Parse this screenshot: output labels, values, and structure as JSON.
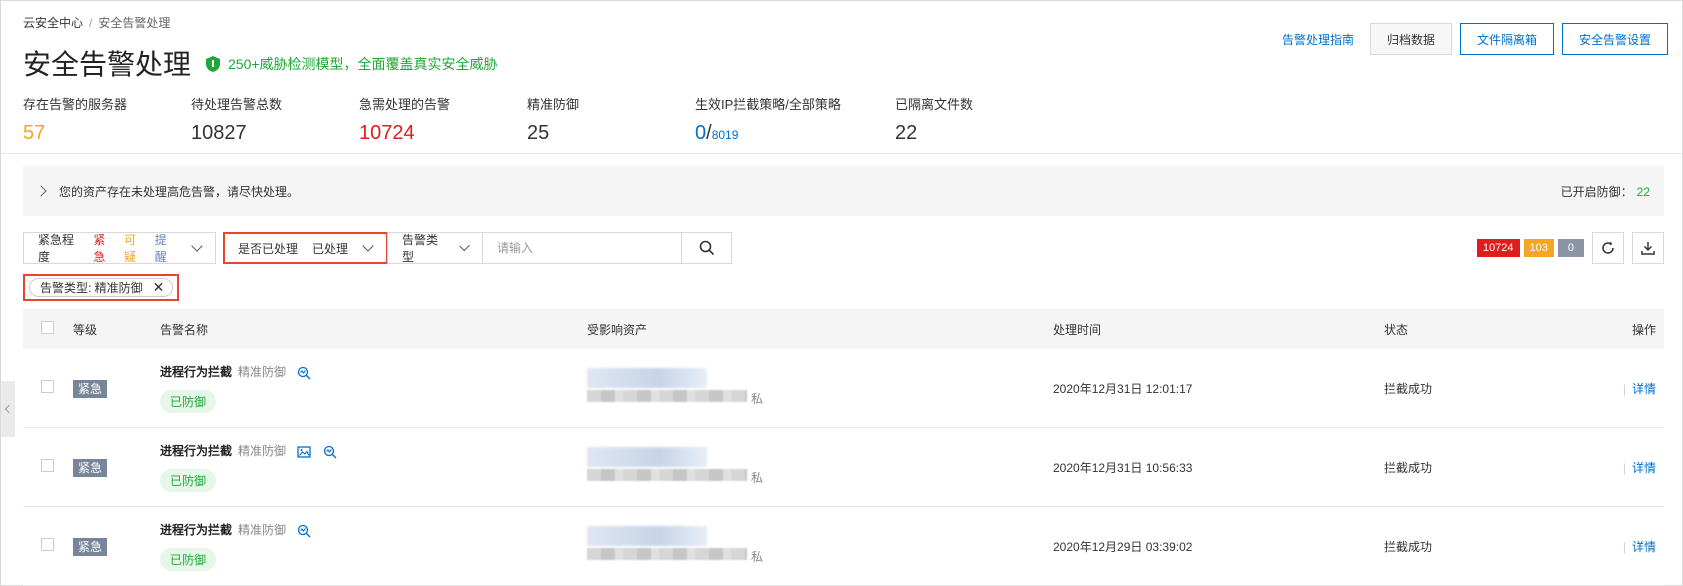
{
  "breadcrumb": {
    "root": "云安全中心",
    "sep": "/",
    "current": "安全告警处理"
  },
  "header": {
    "title": "安全告警处理",
    "badge_text": "250+威胁检测模型，全面覆盖真实安全威胁",
    "guide_link": "告警处理指南",
    "archive_btn": "归档数据",
    "quarantine_btn": "文件隔离箱",
    "settings_btn": "安全告警设置"
  },
  "stats": [
    {
      "label": "存在告警的服务器",
      "value": "57"
    },
    {
      "label": "待处理告警总数",
      "value": "10827"
    },
    {
      "label": "急需处理的告警",
      "value": "10724"
    },
    {
      "label": "精准防御",
      "value": "25"
    },
    {
      "label": "生效IP拦截策略/全部策略",
      "value": "0",
      "value_sep": "/",
      "value_total": "8019"
    },
    {
      "label": "已隔离文件数",
      "value": "22"
    }
  ],
  "notice": {
    "text": "您的资产存在未处理高危告警，请尽快处理。",
    "right_label": "已开启防御：",
    "right_value": "22"
  },
  "filters": {
    "severity_label": "紧急程度",
    "severity_urgent": "紧急",
    "severity_suspicious": "可疑",
    "severity_remind": "提醒",
    "handled_label": "是否已处理",
    "handled_value": "已处理",
    "type_label": "告警类型",
    "search_placeholder": "请输入"
  },
  "counts": {
    "red": "10724",
    "orange": "103",
    "gray": "0"
  },
  "chip": {
    "text": "告警类型: 精准防御"
  },
  "table": {
    "headers": {
      "level": "等级",
      "name": "告警名称",
      "asset": "受影响资产",
      "time": "处理时间",
      "status": "状态",
      "op": "操作"
    },
    "rows": [
      {
        "level": "紧急",
        "name": "进程行为拦截",
        "sub": "精准防御",
        "tag": "已防御",
        "asset_suffix": "私",
        "time": "2020年12月31日 12:01:17",
        "status": "拦截成功",
        "op": "详情"
      },
      {
        "level": "紧急",
        "name": "进程行为拦截",
        "sub": "精准防御",
        "tag": "已防御",
        "asset_suffix": "私",
        "time": "2020年12月31日 10:56:33",
        "status": "拦截成功",
        "op": "详情"
      },
      {
        "level": "紧急",
        "name": "进程行为拦截",
        "sub": "精准防御",
        "tag": "已防御",
        "asset_suffix": "私",
        "time": "2020年12月29日 03:39:02",
        "status": "拦截成功",
        "op": "详情"
      }
    ]
  },
  "colors": {
    "accent": "#0070cc",
    "urgent": "#e01c1c",
    "warning": "#f5a623",
    "success": "#1fa839",
    "highlight": "#e8442f"
  }
}
